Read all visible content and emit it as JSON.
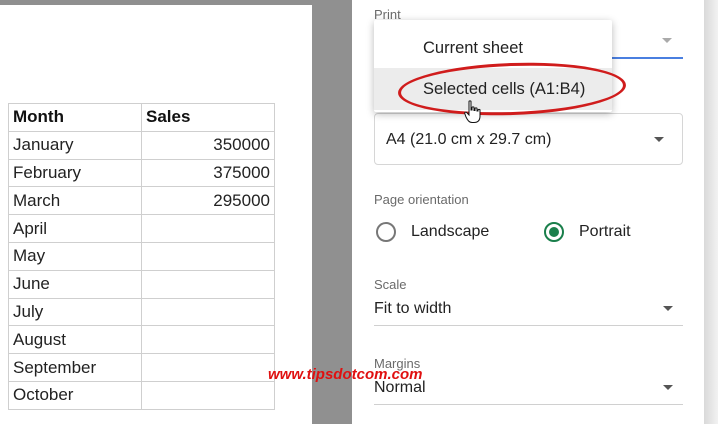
{
  "sheet": {
    "headers": [
      "Month",
      "Sales"
    ],
    "rows": [
      [
        "January",
        "350000"
      ],
      [
        "February",
        "375000"
      ],
      [
        "March",
        "295000"
      ],
      [
        "April",
        ""
      ],
      [
        "May",
        ""
      ],
      [
        "June",
        ""
      ],
      [
        "July",
        ""
      ],
      [
        "August",
        ""
      ],
      [
        "September",
        ""
      ],
      [
        "October",
        ""
      ]
    ]
  },
  "print": {
    "label": "Print",
    "options": [
      "Current sheet",
      "Selected cells (A1:B4)"
    ]
  },
  "paper_size": {
    "value": "A4 (21.0 cm x 29.7 cm)"
  },
  "orientation": {
    "label": "Page orientation",
    "landscape": "Landscape",
    "portrait": "Portrait",
    "selected": "Portrait"
  },
  "scale": {
    "label": "Scale",
    "value": "Fit to width"
  },
  "margins": {
    "label": "Margins",
    "value": "Normal"
  },
  "watermark": "www.tipsdotcom.com",
  "colors": {
    "accent_green": "#1a7f4b",
    "highlight_red": "#d01c1c"
  }
}
